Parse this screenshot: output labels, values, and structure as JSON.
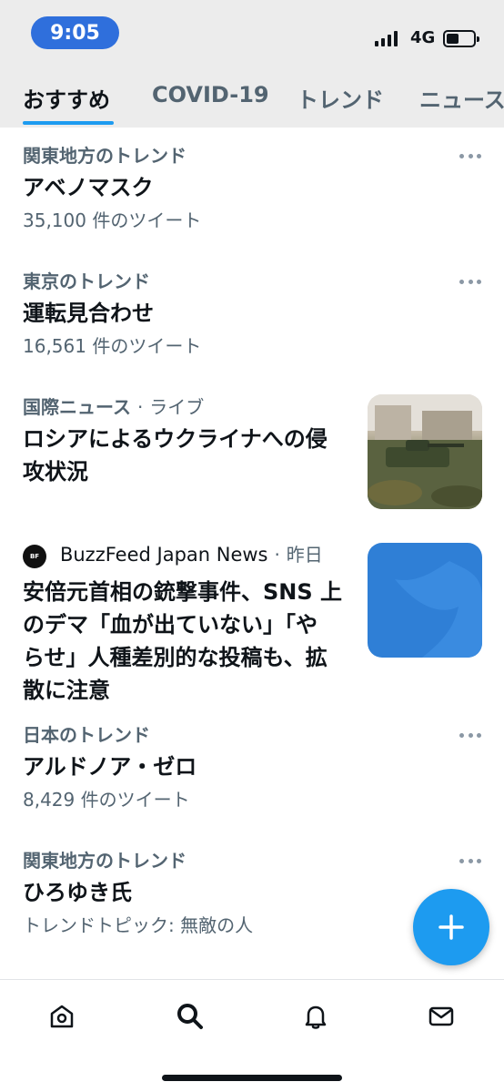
{
  "status_bar": {
    "time": "9:05",
    "network": "4G",
    "battery_level": 0.45
  },
  "tabs": [
    {
      "label": "おすすめ",
      "active": true
    },
    {
      "label": "COVID-19",
      "active": false
    },
    {
      "label": "トレンド",
      "active": false
    },
    {
      "label": "ニュース",
      "active": false
    }
  ],
  "trends": [
    {
      "context": "関東地方のトレンド",
      "title": "アベノマスク",
      "meta": "35,100 件のツイート"
    },
    {
      "context": "東京のトレンド",
      "title": "運転見合わせ",
      "meta": "16,561 件のツイート"
    },
    {
      "context": "日本のトレンド",
      "title": "アルドノア・ゼロ",
      "meta": "8,429 件のツイート"
    },
    {
      "context": "関東地方のトレンド",
      "title": "ひろゆき氏",
      "meta": "トレンドトピック: 無敵の人"
    }
  ],
  "news": [
    {
      "category": "国際ニュース",
      "separator": "·",
      "status": "ライブ",
      "title_lines": [
        "ロシアによるウクライナへの侵",
        "攻状況"
      ]
    },
    {
      "source_logo": "BuzzFeed News JP",
      "source": "BuzzFeed Japan News",
      "separator": "·",
      "time": "昨日",
      "title_lines": [
        "安倍元首相の銃撃事件、SNS 上",
        "のデマ「血が出ていない」「や",
        "らせ」人種差別的な投稿も、拡",
        "散に注意"
      ]
    }
  ],
  "colors": {
    "accent": "#1d9bf0",
    "time_pill": "#2f6fdc",
    "secondary_text": "#536471",
    "primary_text": "#0f1419"
  },
  "icons": {
    "fab": "plus-icon",
    "more": "more-dots-icon",
    "nav": [
      "home-icon",
      "search-icon",
      "bell-icon",
      "mail-icon"
    ]
  }
}
